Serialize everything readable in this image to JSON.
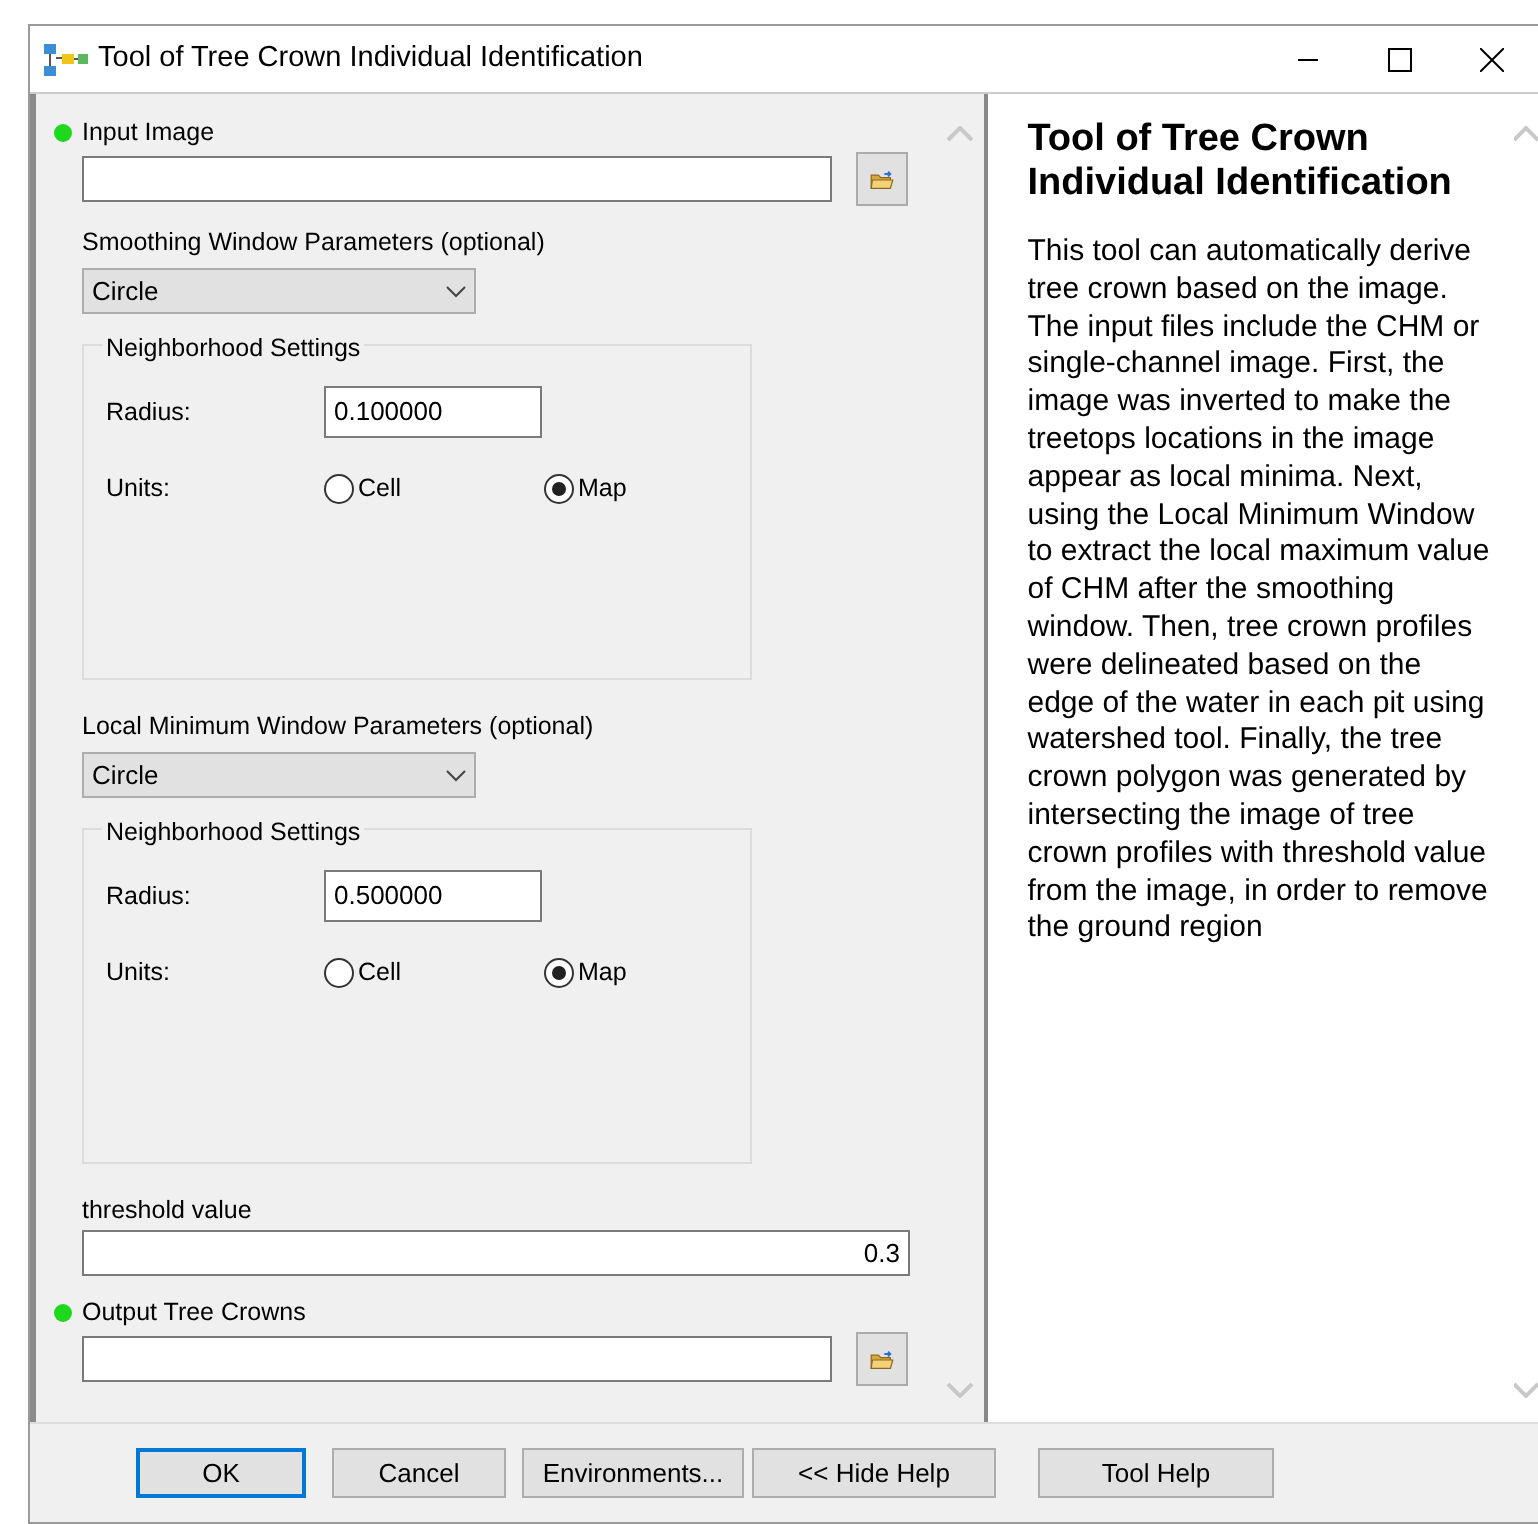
{
  "window": {
    "title": "Tool of Tree Crown Individual Identification"
  },
  "parameters": [
    {
      "kind": "file",
      "label": "Input Image",
      "required": true
    },
    {
      "kind": "group",
      "label": "Smoothing Window Parameters (optional)",
      "dropdown": "Circle",
      "settings_title": "Neighborhood Settings",
      "radius_label": "Radius:",
      "radius": "0.100000",
      "units_label": "Units:",
      "units": [
        {
          "label": "Cell",
          "selected": false
        },
        {
          "label": "Map",
          "selected": true
        }
      ]
    },
    {
      "kind": "group",
      "label": "Local Minimum Window Parameters  (optional)",
      "dropdown": "Circle",
      "settings_title": "Neighborhood Settings",
      "radius_label": "Radius:",
      "radius": "0.500000",
      "units_label": "Units:",
      "units": [
        {
          "label": "Cell",
          "selected": false
        },
        {
          "label": "Map",
          "selected": true
        }
      ]
    },
    {
      "kind": "number",
      "label": "threshold value",
      "value": "0.3",
      "required": false
    },
    {
      "kind": "file",
      "label": "Output Tree Crowns",
      "required": true
    }
  ],
  "help": {
    "title": "Tool of Tree Crown Individual Identification",
    "body": "This tool can automatically derive tree crown based on the image. The input files include the CHM or single-channel image. First, the image was inverted to make the treetops locations in the image appear as local minima. Next, using the Local Minimum Window to extract the local maximum value of CHM after the smoothing window. Then, tree crown profiles were delineated based on the edge of the water in each pit using watershed tool. Finally, the tree crown polygon was generated by intersecting the image of tree crown profiles with threshold value from the image, in order to remove the ground region"
  },
  "buttons": [
    {
      "label": "OK",
      "default": true
    },
    {
      "label": "Cancel",
      "default": false
    },
    {
      "label": "Environments...",
      "default": false
    },
    {
      "label": "<< Hide Help",
      "default": false
    },
    {
      "label": "Tool Help",
      "default": false
    }
  ]
}
